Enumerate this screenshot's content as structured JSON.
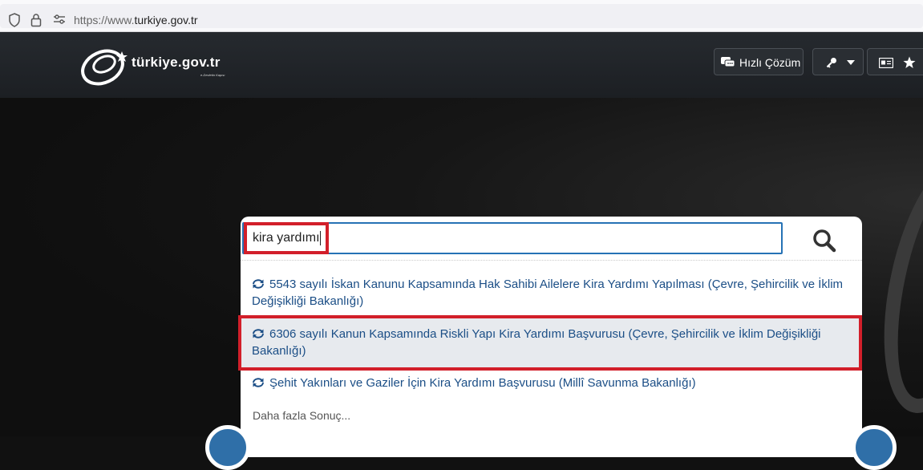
{
  "browser": {
    "url_prefix": "https://www.",
    "url_domain": "turkiye.gov.tr"
  },
  "header": {
    "logo_text": "türkiye.gov.tr",
    "logo_subtext": "e-Devletin Kapısı",
    "quick_solution_label": "Hızlı Çözüm"
  },
  "search": {
    "query": "kira yardımı",
    "results": [
      {
        "line1": "5543 sayılı İskan Kanunu Kapsamında Hak Sahibi Ailelere Kira Yardımı Yapılması (Çevre, Şehircilik ve İklim",
        "line2": "Değişikliği Bakanlığı)"
      },
      {
        "line1": "6306 sayılı Kanun Kapsamında Riskli Yapı Kira Yardımı Başvurusu (Çevre, Şehircilik ve İklim Değişikliği",
        "line2": "Bakanlığı)"
      },
      {
        "line1": "Şehit Yakınları ve Gaziler İçin Kira Yardımı Başvurusu (Millî Savunma Bakanlığı)",
        "line2": ""
      }
    ],
    "more_label": "Daha fazla Sonuç..."
  },
  "colors": {
    "link": "#1b4e86",
    "highlight_red": "#d21f2a",
    "input_border": "#2672b5",
    "active_row": "#e7eaee"
  },
  "icons": [
    "shield-icon",
    "lock-icon",
    "tune-icon",
    "chat-icon",
    "key-icon",
    "caret-down-icon",
    "id-card-icon",
    "star-icon",
    "search-icon",
    "refresh-icon"
  ]
}
